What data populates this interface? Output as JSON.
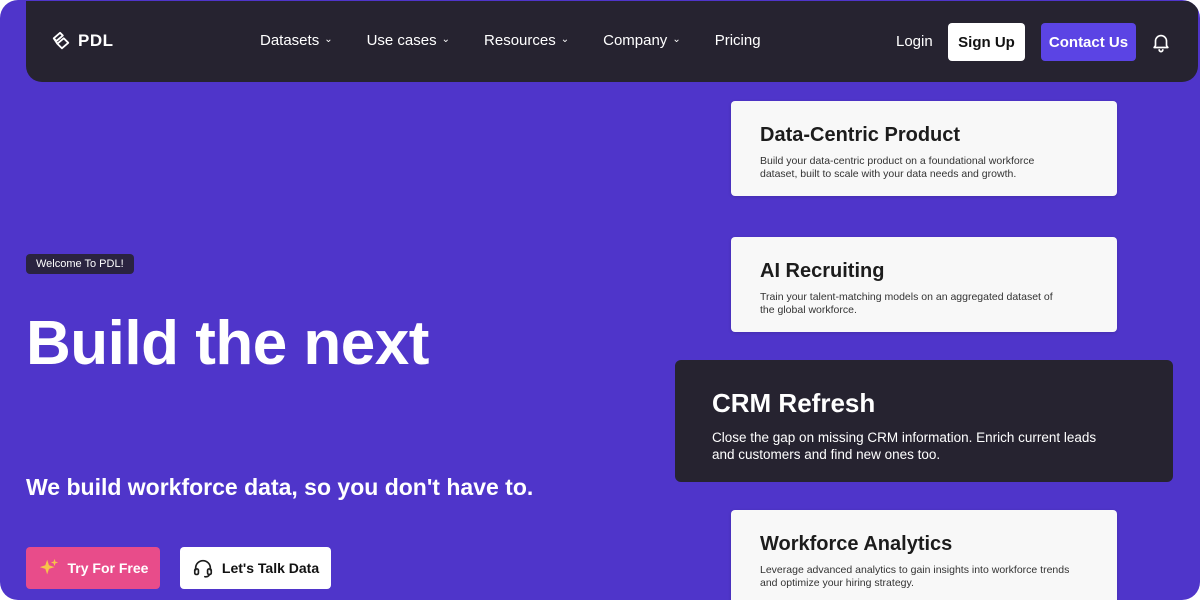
{
  "brand": {
    "name": "PDL"
  },
  "nav": {
    "items": [
      {
        "label": "Datasets",
        "has_dropdown": true
      },
      {
        "label": "Use cases",
        "has_dropdown": true
      },
      {
        "label": "Resources",
        "has_dropdown": true
      },
      {
        "label": "Company",
        "has_dropdown": true
      },
      {
        "label": "Pricing",
        "has_dropdown": false
      }
    ],
    "login": "Login",
    "signup": "Sign Up",
    "contact": "Contact Us",
    "chevron": "⌄"
  },
  "hero": {
    "badge": "Welcome To PDL!",
    "headline": "Build the next",
    "subhead": "We build workforce data, so you don't have to.",
    "try_button": "Try For Free",
    "talk_button": "Let's Talk Data"
  },
  "cards": [
    {
      "title": "Data-Centric Product",
      "desc": "Build your data-centric product on a foundational workforce dataset, built to scale with your data needs and growth."
    },
    {
      "title": "AI Recruiting",
      "desc": "Train your talent-matching models on an aggregated dataset of the global workforce."
    },
    {
      "title": "CRM Refresh",
      "desc": "Close the gap on missing CRM information. Enrich current leads and customers and find new ones too."
    },
    {
      "title": "Workforce Analytics",
      "desc": "Leverage advanced analytics to gain insights into workforce trends and optimize your hiring strategy."
    }
  ],
  "colors": {
    "background": "#4f35ca",
    "navbar": "#262330",
    "accent": "#5b44e4",
    "try_button": "#e84c8a",
    "card": "#f8f8f8"
  },
  "icons": {
    "logo": "pdl-logo-icon",
    "bell": "bell-icon",
    "sparkle": "sparkle-icon",
    "headset": "headset-icon"
  }
}
